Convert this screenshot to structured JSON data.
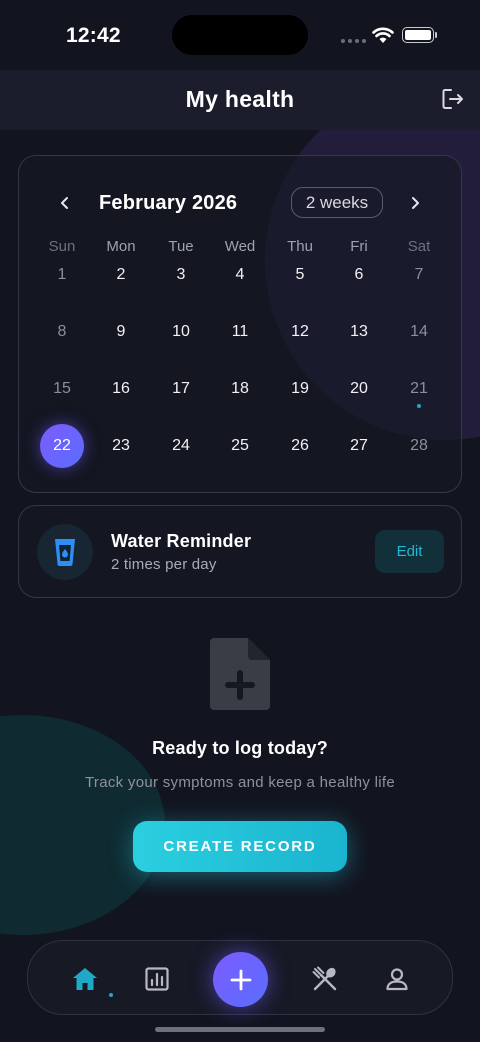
{
  "status_bar": {
    "time": "12:42"
  },
  "header": {
    "title": "My health"
  },
  "calendar": {
    "month_label": "February 2026",
    "range_label": "2 weeks",
    "weekdays": [
      "Sun",
      "Mon",
      "Tue",
      "Wed",
      "Thu",
      "Fri",
      "Sat"
    ],
    "weeks": [
      [
        "1",
        "2",
        "3",
        "4",
        "5",
        "6",
        "7"
      ],
      [
        "8",
        "9",
        "10",
        "11",
        "12",
        "13",
        "14"
      ],
      [
        "15",
        "16",
        "17",
        "18",
        "19",
        "20",
        "21"
      ],
      [
        "22",
        "23",
        "24",
        "25",
        "26",
        "27",
        "28"
      ]
    ],
    "selected_day": "22",
    "marked_days": [
      "21"
    ]
  },
  "reminder": {
    "title": "Water Reminder",
    "subtitle": "2 times per day",
    "edit_label": "Edit",
    "icon": "water-glass-icon"
  },
  "empty_state": {
    "icon": "add-document-icon",
    "title": "Ready to log today?",
    "subtitle": "Track your symptoms and keep a healthy life",
    "button_label": "CREATE RECORD"
  },
  "tab_bar": {
    "items": [
      "home-icon",
      "chart-icon",
      "add-icon",
      "fork-knife-icon",
      "profile-icon"
    ],
    "active": "home-icon"
  },
  "colors": {
    "background": "#121520",
    "header": "#1b1c2c",
    "accent_purple": "#6b62ff",
    "accent_teal": "#22b8d4",
    "water_blue": "#2f8ef5"
  }
}
